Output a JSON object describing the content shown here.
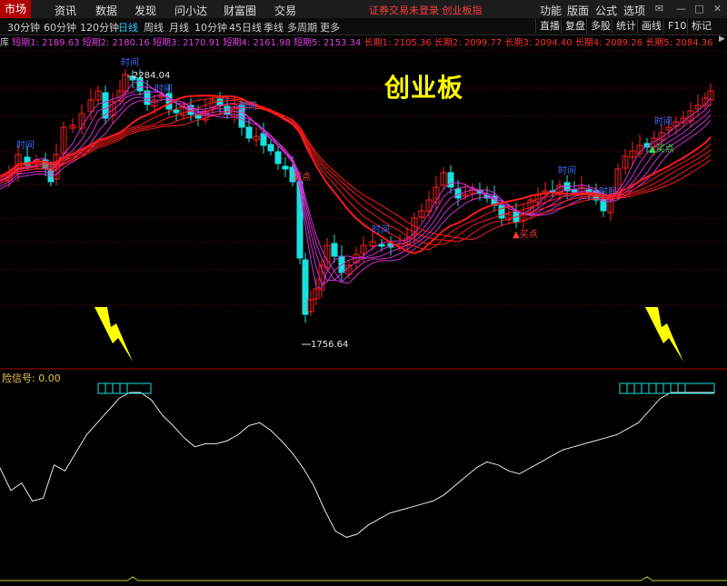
{
  "menubar": {
    "items": [
      "市场",
      "资讯",
      "数据",
      "发现",
      "问小达",
      "财富圈",
      "交易"
    ],
    "notice": "证券交易未登录  创业板指",
    "right_items": [
      "功能",
      "版面",
      "公式",
      "选项"
    ]
  },
  "toolbar": {
    "periods": [
      "30分钟",
      "60分钟",
      "120分钟",
      "日线",
      "周线",
      "月线",
      "10分钟",
      "45日线",
      "季线",
      "多周期",
      "更多"
    ],
    "active_period": "日线",
    "right_buttons": [
      "直播",
      "复盘",
      "多股",
      "统计",
      "画线",
      "F10",
      "标记"
    ]
  },
  "legend": {
    "short": [
      "短期1: 2189.63",
      "短期2: 2180.16",
      "短期3: 2170.91",
      "短期4: 2161.98",
      "短期5: 2153.34"
    ],
    "long": [
      "长期1: 2105.36",
      "长期2: 2099.77",
      "长期3: 2094.40",
      "长期4: 2089.26",
      "长期5: 2084.36"
    ]
  },
  "colors": {
    "up": "#ff2020",
    "down": "#19e0e0",
    "short_ma": "#d030d0",
    "long_ma": "#ff1a1a",
    "signal_line": "#e8e8e8",
    "lightning": "#ffff00"
  },
  "watermark": "创业板",
  "annotations": {
    "high": "2284.04",
    "low": "1756.64"
  },
  "signals": {
    "time": "时间",
    "buy": "买点",
    "up": "▲买点"
  },
  "bottom_panel": {
    "label": "险信号: 0.00"
  },
  "chart_data": {
    "type": "candlestick",
    "price_axis_range": [
      1740,
      2320
    ],
    "indicator_range": [
      0,
      100
    ],
    "indicator_signal": [
      50,
      35,
      40,
      28,
      30,
      52,
      48,
      60,
      72,
      80,
      88,
      96,
      100,
      100,
      95,
      85,
      78,
      70,
      64,
      66,
      66,
      68,
      72,
      78,
      80,
      75,
      68,
      60,
      50,
      38,
      22,
      8,
      4,
      6,
      12,
      16,
      20,
      22,
      24,
      26,
      28,
      32,
      38,
      44,
      50,
      54,
      52,
      48,
      46,
      50,
      54,
      58,
      62,
      64,
      66,
      68,
      70,
      72,
      76,
      80,
      88,
      96,
      100,
      100,
      100,
      100,
      100
    ]
  }
}
